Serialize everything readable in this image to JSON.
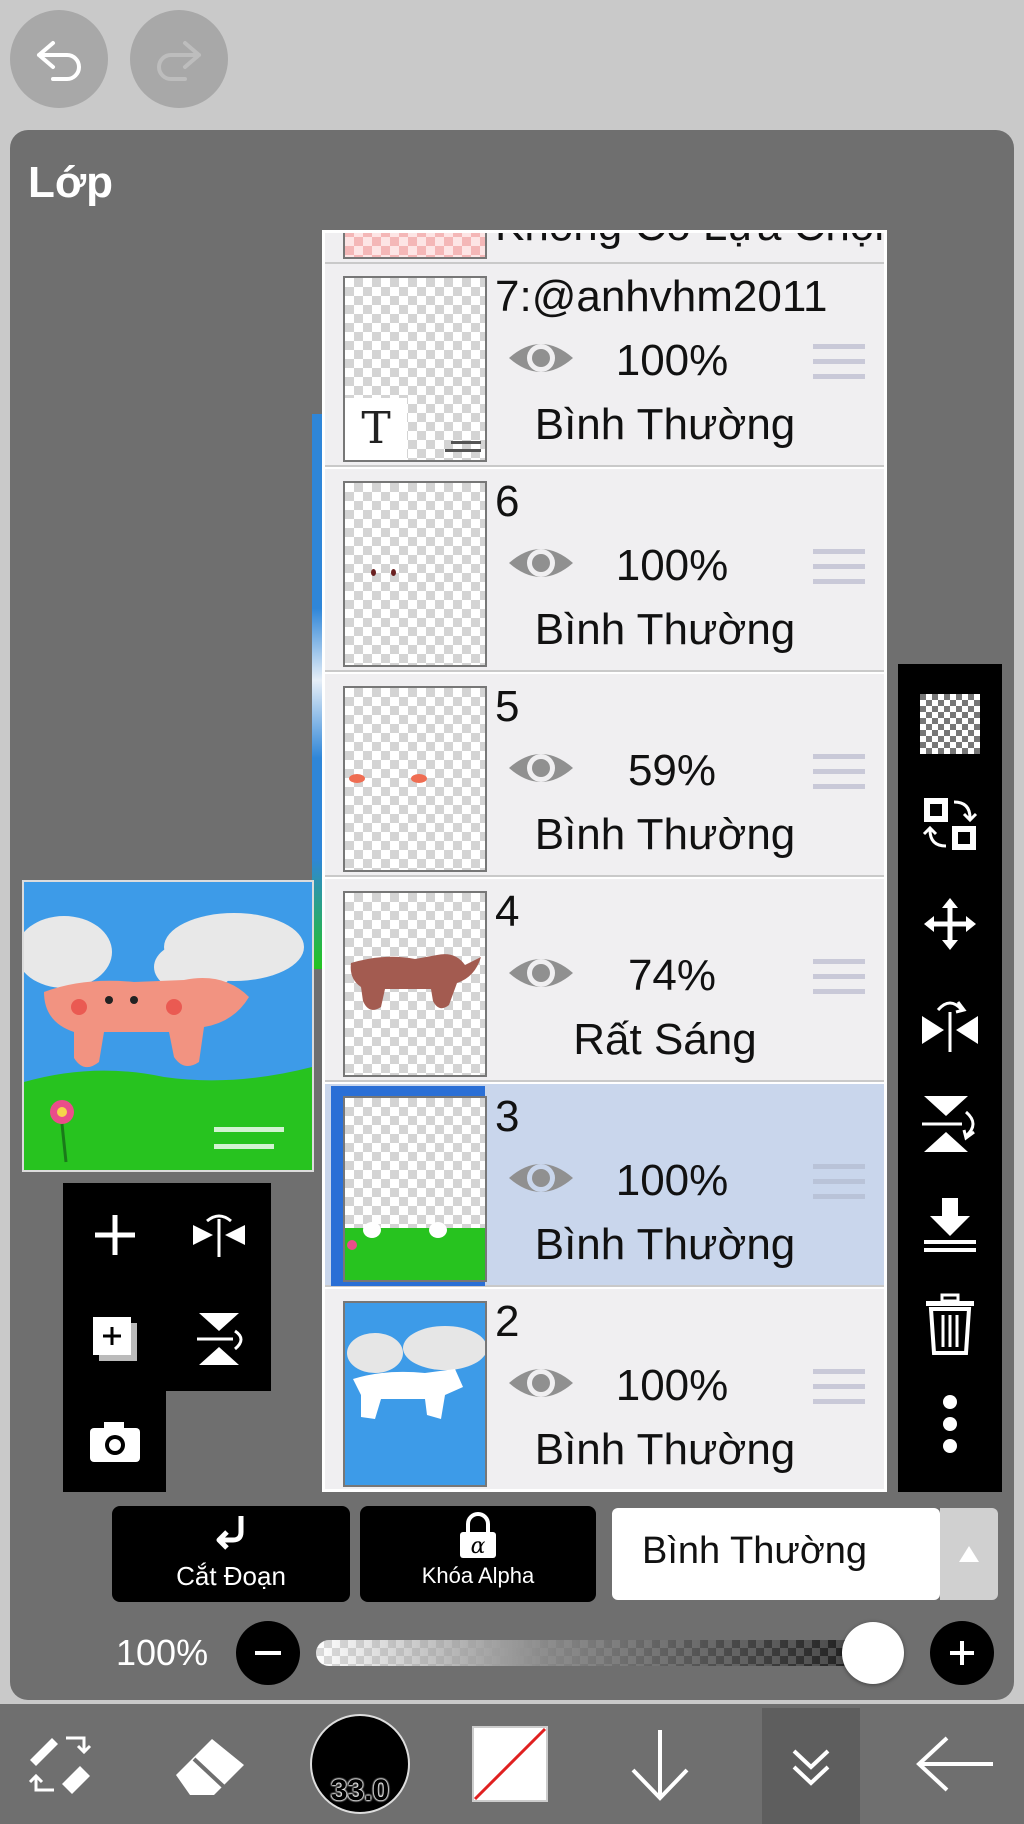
{
  "panel": {
    "title": "Lớp"
  },
  "layers": [
    {
      "name": "Không Có Lựa Chọn"
    },
    {
      "name": "7:@anhvhm2011",
      "opacity": "100%",
      "blend": "Bình Thường"
    },
    {
      "name": "6",
      "opacity": "100%",
      "blend": "Bình Thường"
    },
    {
      "name": "5",
      "opacity": "59%",
      "blend": "Bình Thường"
    },
    {
      "name": "4",
      "opacity": "74%",
      "blend": "Rất Sáng"
    },
    {
      "name": "3",
      "opacity": "100%",
      "blend": "Bình Thường",
      "selected": true
    },
    {
      "name": "2",
      "opacity": "100%",
      "blend": "Bình Thường"
    }
  ],
  "controls": {
    "clip_label": "Cắt Đoạn",
    "alpha_lock_label": "Khóa Alpha",
    "blend_mode": "Bình Thường",
    "opacity_label": "100%",
    "opacity_value": 1.0
  },
  "bottom": {
    "brush_size": "33.0"
  },
  "colors": {
    "selected_row": "#c9d6ec",
    "selected_border": "#2a6fd6",
    "panel": "#6f6f6f"
  }
}
